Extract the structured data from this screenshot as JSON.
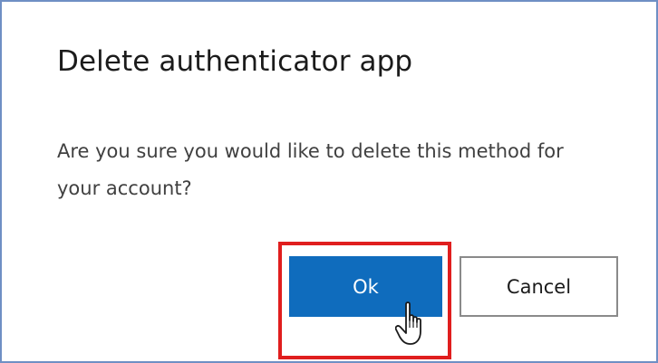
{
  "dialog": {
    "title": "Delete authenticator app",
    "message": "Are you sure you would like to delete this method for your account?",
    "ok_label": "Ok",
    "cancel_label": "Cancel"
  },
  "colors": {
    "primary_button": "#0f6cbd",
    "highlight": "#e01e1e",
    "frame_border": "#6f8fc4"
  },
  "cursor": {
    "icon": "hand-pointer-icon"
  }
}
